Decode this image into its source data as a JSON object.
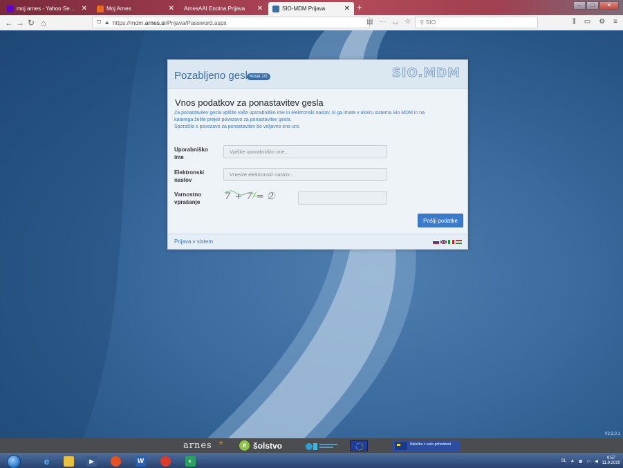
{
  "browser": {
    "tabs": [
      {
        "label": "moj arnes - Yahoo Search Resu",
        "favicon_color": "#6001d2",
        "active": false
      },
      {
        "label": "Moj Arnes",
        "favicon_color": "#e86a1a",
        "active": false
      },
      {
        "label": "ArnesAAI Enotna Prijava",
        "favicon_color": "",
        "active": false
      },
      {
        "label": "SIO-MDM Prijava",
        "favicon_color": "#3a6ea5",
        "active": true
      }
    ],
    "new_tab_glyph": "+",
    "url_prefix": "https://mdm.",
    "url_domain": "arnes.si",
    "url_path": "/Prijava/Password.aspx",
    "search_placeholder": "SIO"
  },
  "card": {
    "title": "Pozabljeno geslo",
    "step_badge": "Korak 1/2",
    "logo": "SIO.MDM",
    "section_title": "Vnos podatkov za ponastavitev gesla",
    "info_line1": "Za ponastavitev gesla vpišite vaše uporabniško ime in elektronski naslov, ki ga imate v okviru sistema Sio MDM in na",
    "info_line2": "katerega želite prejeti povezavo za ponastavitev gesla.",
    "info_line3": "Sporočilo s povezavo za ponastavitev bo veljavno eno uro.",
    "fields": {
      "username_label1": "Uporabniško",
      "username_label2": "ime",
      "username_placeholder": "Vpišite uporabniško ime...",
      "email_label1": "Elektronski",
      "email_label2": "naslov",
      "email_placeholder": "Vnesite elektronski naslov...",
      "captcha_label1": "Varnostno",
      "captcha_label2": "vprašanje",
      "captcha_text": "7 + 7 = 2"
    },
    "submit_label": "Pošlji podatke",
    "footer_link": "Prijava v sistem"
  },
  "page": {
    "version": "V2.3.0.1"
  },
  "footer_strip": {
    "arnes": "arnes",
    "solstvo_icon": "e",
    "solstvo": "šolstvo",
    "nalozba": "Naložba v vašo prihodnost"
  },
  "taskbar": {
    "lang": "SL",
    "time": "9:57",
    "date": "11.9.2020"
  }
}
